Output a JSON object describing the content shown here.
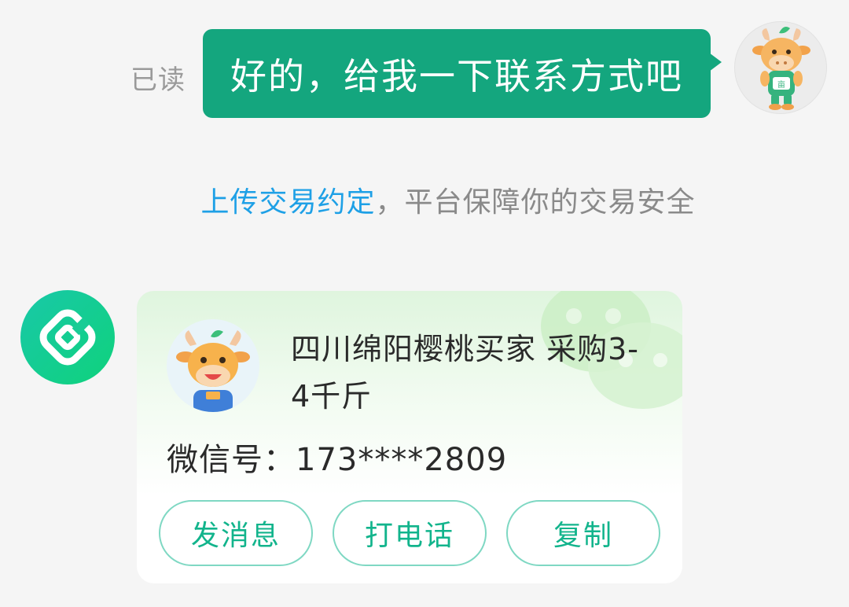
{
  "outgoing": {
    "read_status": "已读",
    "message": "好的，给我一下联系方式吧",
    "avatar_icon": "cow-mascot-avatar-icon"
  },
  "notice": {
    "link_text": "上传交易约定",
    "rest_text": "，平台保障你的交易安全"
  },
  "incoming": {
    "sender_icon": "platform-logo-icon",
    "card": {
      "buyer_avatar_icon": "cow-mascot-avatar-icon",
      "title": "四川绵阳樱桃买家 采购3-4千斤",
      "wechat_label": "微信号：",
      "wechat_value": "173****2809",
      "background_icon": "wechat-icon",
      "actions": [
        {
          "label": "发消息"
        },
        {
          "label": "打电话"
        },
        {
          "label": "复制"
        }
      ]
    }
  },
  "colors": {
    "bubble_green": "#14a67e",
    "link_blue": "#1ea0e6",
    "action_green": "#12b48c"
  }
}
